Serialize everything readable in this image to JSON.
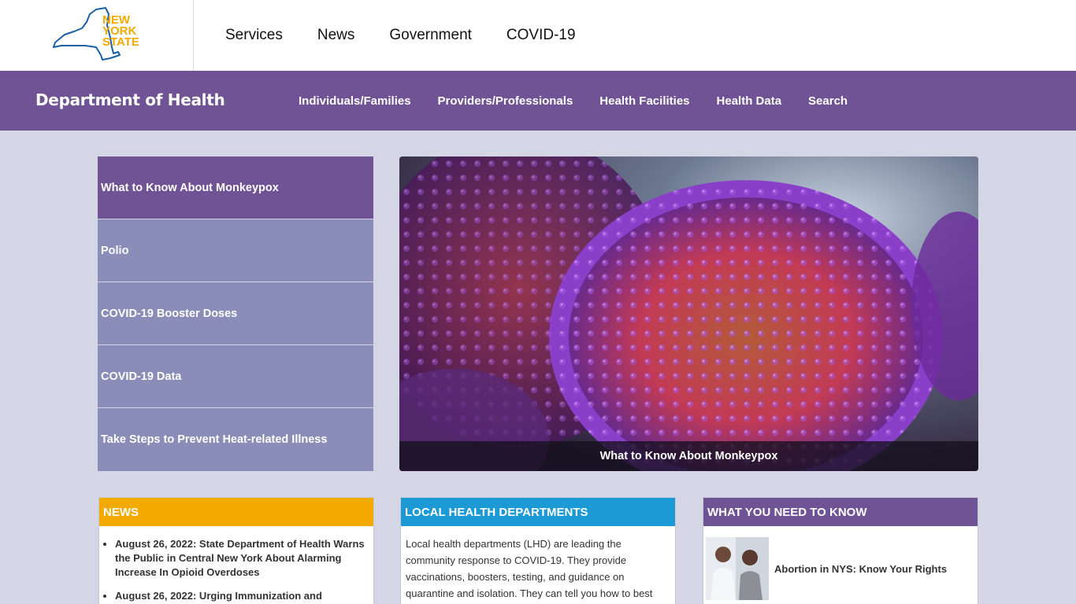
{
  "logo": {
    "lines": [
      "NEW",
      "YORK",
      "STATE"
    ],
    "colors": {
      "outline": "#1b5fa8",
      "text": "#f2a900"
    }
  },
  "topnav": [
    "Services",
    "News",
    "Government",
    "COVID-19"
  ],
  "dept": {
    "title": "Department of Health",
    "nav": [
      "Individuals/Families",
      "Providers/Professionals",
      "Health Facilities",
      "Health Data",
      "Search"
    ]
  },
  "features": [
    "What to Know About Monkeypox",
    "Polio",
    "COVID-19 Booster Doses",
    "COVID-19 Data",
    "Take Steps to Prevent Heat-related Illness"
  ],
  "hero": {
    "caption": "What to Know About Monkeypox"
  },
  "cards": {
    "news": {
      "title": "NEWS",
      "items": [
        "August 26, 2022: State Department of Health Warns the Public in Central New York About Alarming Increase In Opioid Overdoses",
        "August 26, 2022: Urging Immunization and"
      ]
    },
    "lhd": {
      "title": "LOCAL HEALTH DEPARTMENTS",
      "text": "Local health departments (LHD) are leading the community response to COVID-19. They provide vaccinations, boosters, testing, and guidance on quarantine and isolation. They can tell you how to best"
    },
    "wyn": {
      "title": "WHAT YOU NEED TO KNOW",
      "item": "Abortion in NYS: Know Your Rights"
    }
  },
  "colors": {
    "purple": "#6f5394",
    "lavender": "#8a8db7",
    "page_bg": "#d4d6e6",
    "news": "#f2a900",
    "lhd": "#1b9ad6"
  }
}
